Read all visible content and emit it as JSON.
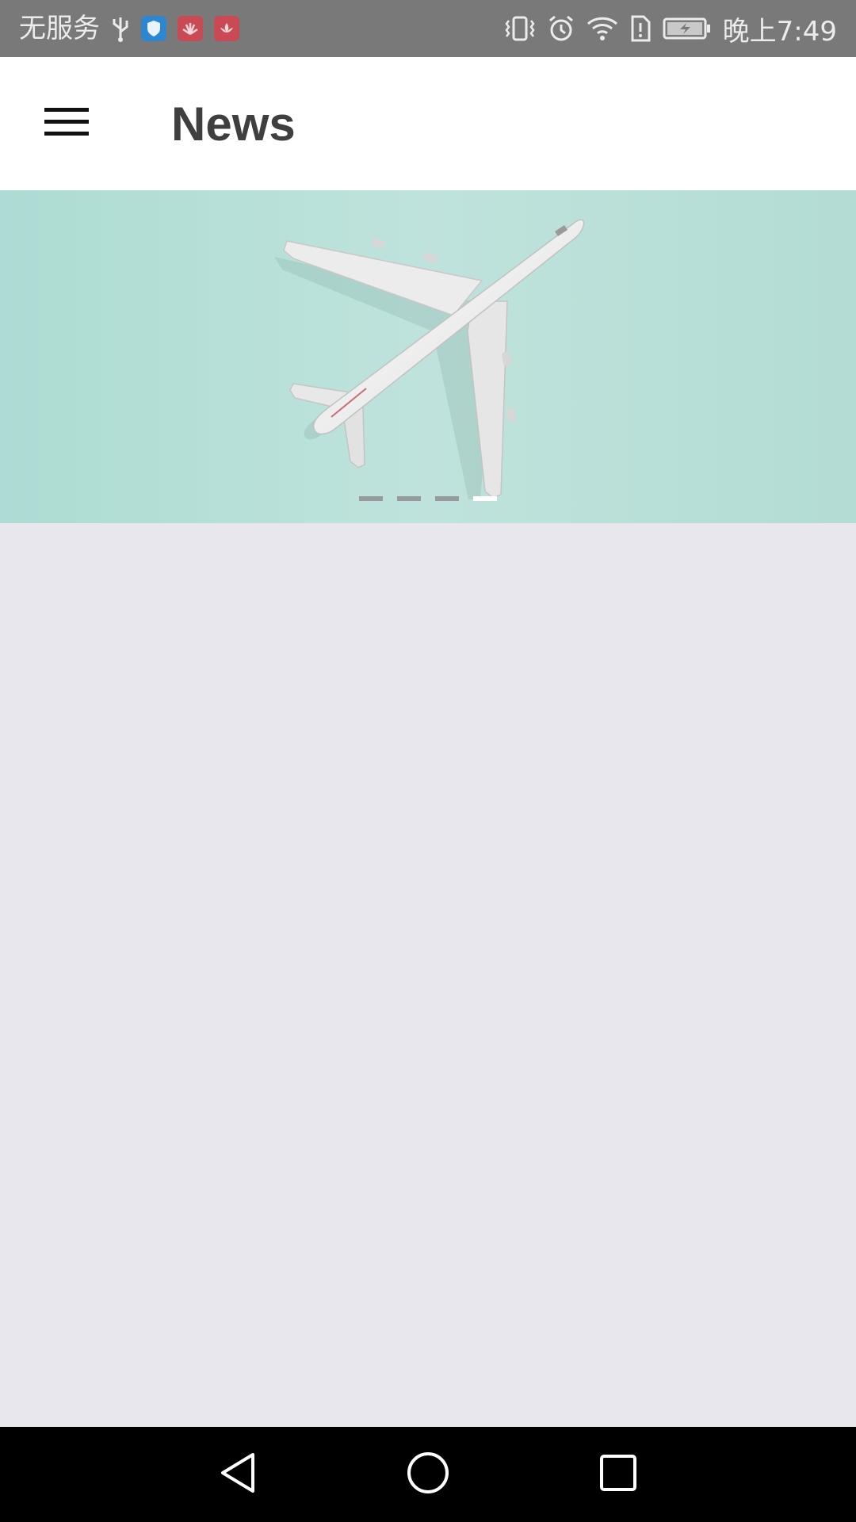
{
  "status_bar": {
    "carrier": "无服务",
    "time": "晚上7:49",
    "icons": [
      "usb-icon",
      "shield-app-icon",
      "huawei-app-icon",
      "lotus-app-icon",
      "vibrate-icon",
      "alarm-icon",
      "wifi-icon",
      "sim-alert-icon",
      "battery-charging-icon"
    ],
    "background": "#797979"
  },
  "toolbar": {
    "menu_icon": "hamburger-menu-icon",
    "title": "News",
    "background": "#ffffff"
  },
  "banner": {
    "image": "airplane-on-mint-background",
    "page_count": 4,
    "active_page": 4,
    "background": "#b6dfd7"
  },
  "content": {
    "background": "#e8e7ee"
  },
  "nav_bar": {
    "buttons": [
      "back-icon",
      "home-icon",
      "recents-icon"
    ],
    "background": "#000000"
  }
}
